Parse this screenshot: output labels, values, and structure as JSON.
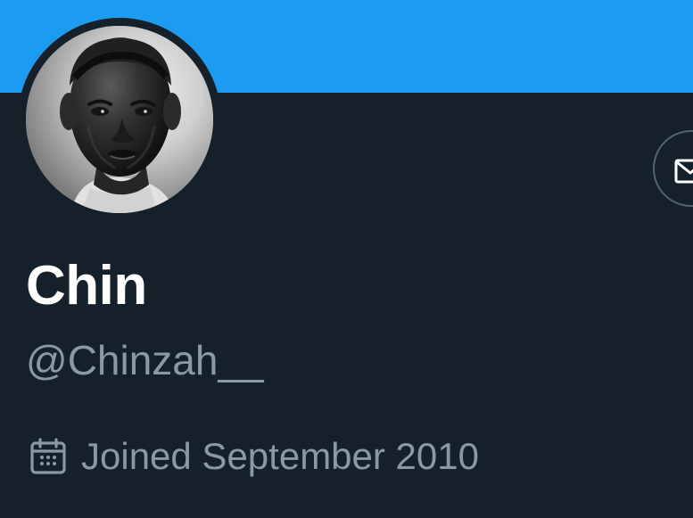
{
  "profile": {
    "display_name": "Chin",
    "handle": "@Chinzah__",
    "joined": "Joined September 2010"
  },
  "icons": {
    "avatar": "profile-photo",
    "message": "envelope-icon",
    "joined": "calendar-icon"
  },
  "colors": {
    "banner": "#1d9bf0",
    "background": "#15202b",
    "primary_text": "#ffffff",
    "secondary_text": "#8b98a5",
    "button_border": "#536471"
  }
}
